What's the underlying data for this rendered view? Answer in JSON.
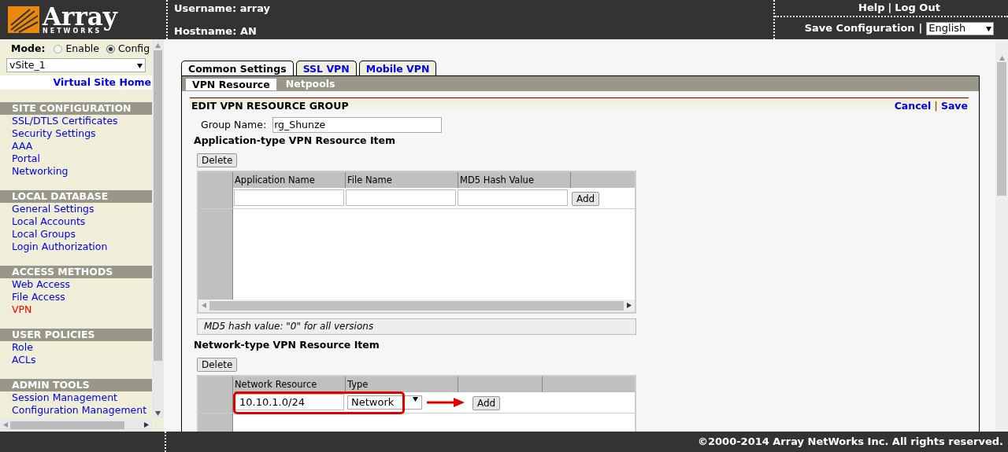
{
  "header": {
    "logo": {
      "name": "Array",
      "tagline": "NETWORKS"
    },
    "username": "Username: array",
    "hostname": "Hostname: AN",
    "links": [
      "Help",
      "Log Out"
    ],
    "save_configuration": "Save Configuration",
    "separators": [
      "|",
      "|"
    ],
    "language": "English"
  },
  "sidebar": {
    "mode_label": "Mode:",
    "modes": [
      {
        "label": "Enable",
        "selected": false
      },
      {
        "label": "Config",
        "selected": true
      }
    ],
    "site": "vSite_1",
    "home_link": "Virtual Site Home",
    "sections": [
      {
        "title": "SITE CONFIGURATION",
        "items": [
          {
            "label": "SSL/DTLS Certificates",
            "selected": false
          },
          {
            "label": "Security Settings",
            "selected": false
          },
          {
            "label": "AAA",
            "selected": false
          },
          {
            "label": "Portal",
            "selected": false
          },
          {
            "label": "Networking",
            "selected": false
          }
        ]
      },
      {
        "title": "LOCAL DATABASE",
        "items": [
          {
            "label": "General Settings",
            "selected": false
          },
          {
            "label": "Local Accounts",
            "selected": false
          },
          {
            "label": "Local Groups",
            "selected": false
          },
          {
            "label": "Login Authorization",
            "selected": false
          }
        ]
      },
      {
        "title": "ACCESS METHODS",
        "items": [
          {
            "label": "Web Access",
            "selected": false
          },
          {
            "label": "File Access",
            "selected": false
          },
          {
            "label": "VPN",
            "selected": true
          }
        ]
      },
      {
        "title": "USER POLICIES",
        "items": [
          {
            "label": "Role",
            "selected": false
          },
          {
            "label": "ACLs",
            "selected": false
          }
        ]
      },
      {
        "title": "ADMIN TOOLS",
        "items": [
          {
            "label": "Session Management",
            "selected": false
          },
          {
            "label": "Configuration Management",
            "selected": false
          }
        ]
      }
    ]
  },
  "main": {
    "tabs": [
      {
        "label": "Common Settings",
        "selected": true
      },
      {
        "label": "SSL VPN",
        "selected": false
      },
      {
        "label": "Mobile VPN",
        "selected": false
      }
    ],
    "subtabs": [
      {
        "label": "VPN Resource",
        "selected": true
      },
      {
        "label": "Netpools",
        "selected": false
      }
    ],
    "form": {
      "title": "EDIT VPN RESOURCE GROUP",
      "actions": [
        "Cancel",
        "Save"
      ],
      "actions_separator": "|",
      "group_name_label": "Group Name:",
      "group_name": "rg_Shunze",
      "application_section": {
        "title": "Application-type VPN Resource Item",
        "delete": "Delete",
        "columns": [
          "Application Name",
          "File Name",
          "MD5 Hash Value"
        ],
        "add": "Add",
        "note": "MD5 hash value: \"0\" for all versions"
      },
      "network_section": {
        "title": "Network-type VPN Resource Item",
        "delete": "Delete",
        "columns": [
          "Network Resource",
          "Type"
        ],
        "resource": "10.10.1.0/24",
        "type": "Network",
        "add": "Add"
      }
    }
  },
  "footer": {
    "copyright": "©2000-2014 Array NetWorks Inc. All rights reserved."
  }
}
